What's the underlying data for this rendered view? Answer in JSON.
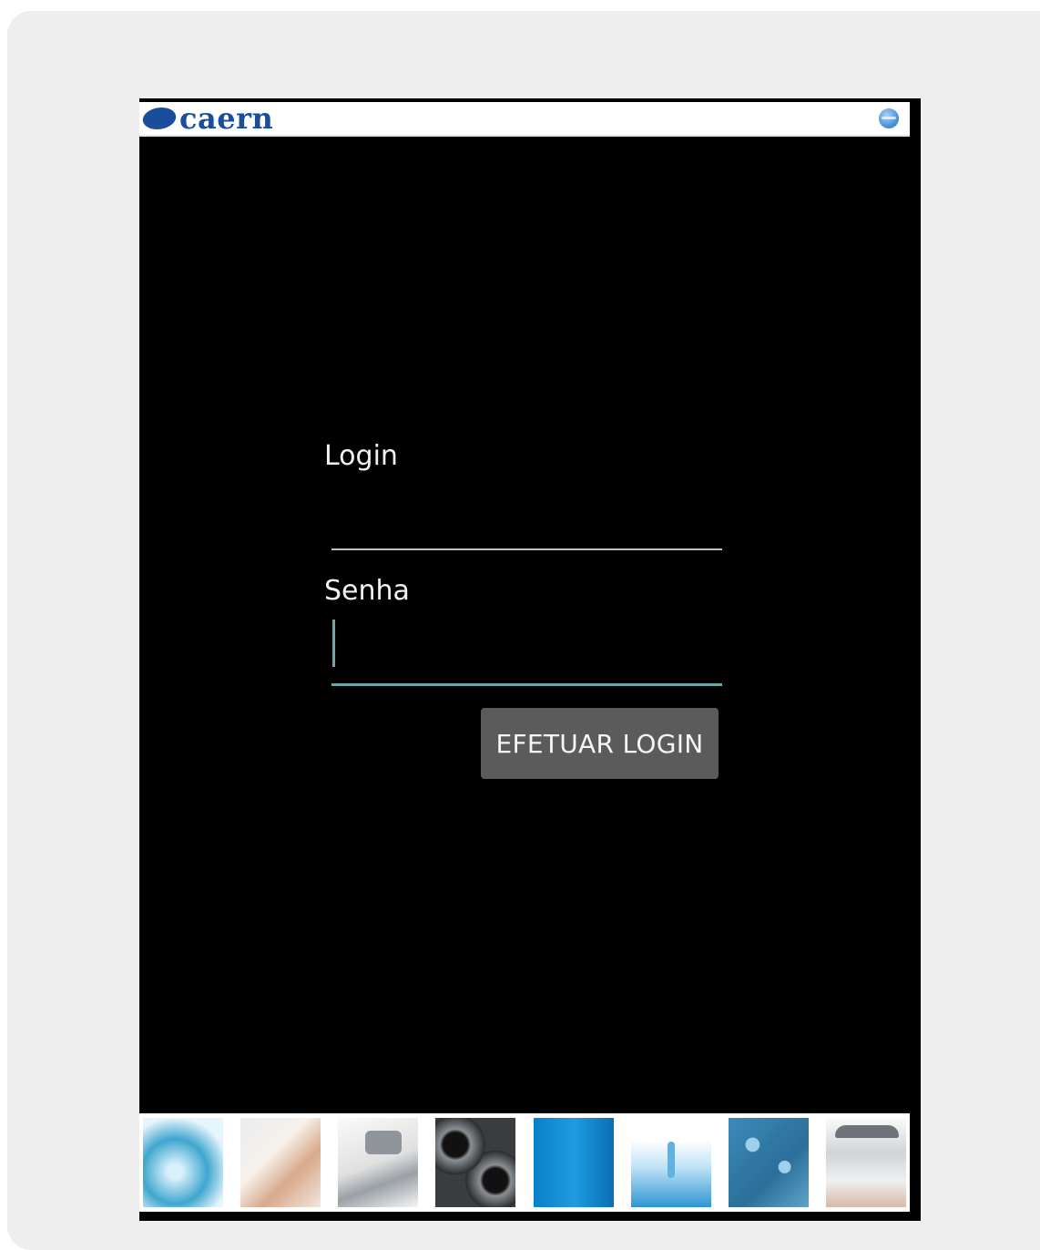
{
  "header": {
    "logo_text": "caern",
    "globe_icon": "globe-icon"
  },
  "form": {
    "login_label": "Login",
    "login_value": "",
    "senha_label": "Senha",
    "senha_value": "",
    "submit_label": "EFETUAR LOGIN"
  },
  "footer": {
    "images": [
      "water-splash-image",
      "drinking-water-image",
      "faucet-image",
      "pipes-image",
      "blue-water-image",
      "water-drop-image",
      "water-bubbles-image",
      "shower-image"
    ]
  },
  "colors": {
    "background": "#000000",
    "accent": "#6fa6a8",
    "button": "#5b5b5b",
    "brand": "#1a4d9c"
  }
}
